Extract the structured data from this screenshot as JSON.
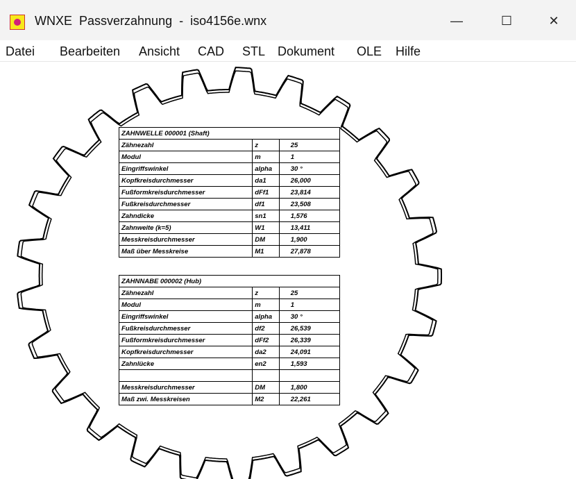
{
  "window": {
    "app_name": "WNXE",
    "title": "WNXE  Passverzahnung  -  iso4156e.wnx",
    "controls": {
      "minimize": "—",
      "maximize": "☐",
      "close": "✕"
    }
  },
  "menu": [
    "Datei",
    "Bearbeiten",
    "Ansicht",
    "CAD",
    "STL",
    "Dokument",
    "OLE",
    "Hilfe"
  ],
  "gear": {
    "teeth": 25,
    "outline_color": "#000000"
  },
  "shaft_table": {
    "header": "ZAHNWELLE 000001 (Shaft)",
    "rows": [
      [
        "Zähnezahl",
        "z",
        "25"
      ],
      [
        "Modul",
        "m",
        "1"
      ],
      [
        "Eingriffswinkel",
        "alpha",
        "30 °"
      ],
      [
        "Kopfkreisdurchmesser",
        "da1",
        "26,000"
      ],
      [
        "Fußformkreisdurchmesser",
        "dFf1",
        "23,814"
      ],
      [
        "Fußkreisdurchmesser",
        "df1",
        "23,508"
      ],
      [
        "Zahndicke",
        "sn1",
        "1,576"
      ],
      [
        "Zahnweite (k=5)",
        "W1",
        "13,411"
      ],
      [
        "Messkreisdurchmesser",
        "DM",
        "1,900"
      ],
      [
        "Maß über Messkreise",
        "M1",
        "27,878"
      ]
    ]
  },
  "hub_table": {
    "header": "ZAHNNABE 000002 (Hub)",
    "rows": [
      [
        "Zähnezahl",
        "z",
        "25"
      ],
      [
        "Modul",
        "m",
        "1"
      ],
      [
        "Eingriffswinkel",
        "alpha",
        "30 °"
      ],
      [
        "Fußkreisdurchmesser",
        "df2",
        "26,539"
      ],
      [
        "Fußformkreisdurchmesser",
        "dFf2",
        "26,339"
      ],
      [
        "Kopfkreisdurchmesser",
        "da2",
        "24,091"
      ],
      [
        "Zahnlücke",
        "en2",
        "1,593"
      ],
      [
        "",
        "",
        ""
      ],
      [
        "Messkreisdurchmesser",
        "DM",
        "1,800"
      ],
      [
        "Maß zwi. Messkreisen",
        "M2",
        "22,261"
      ]
    ]
  }
}
